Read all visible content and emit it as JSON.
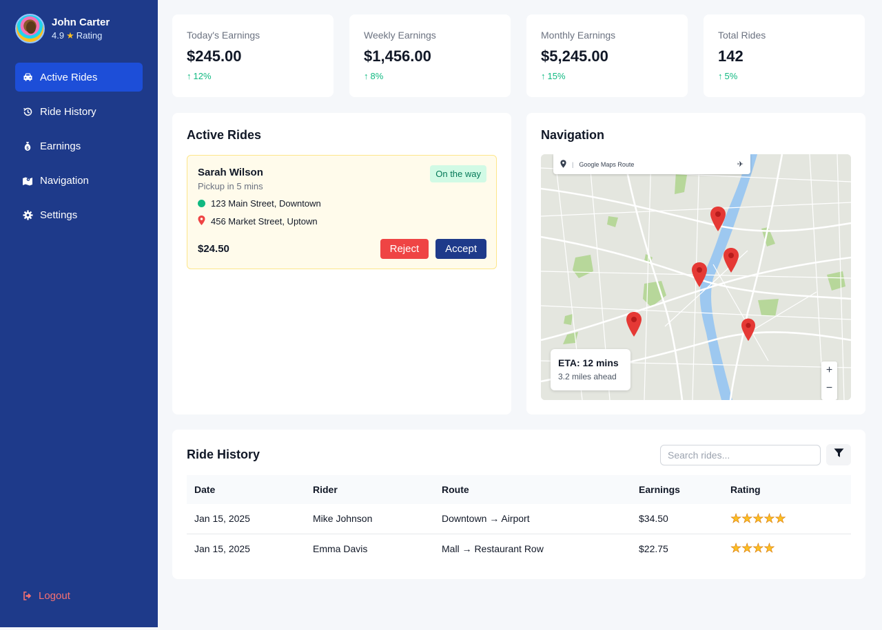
{
  "profile": {
    "name": "John Carter",
    "rating": "4.9",
    "rating_label": "Rating"
  },
  "nav": [
    {
      "label": "Active Rides",
      "icon": "car-icon",
      "active": true
    },
    {
      "label": "Ride History",
      "icon": "history-icon"
    },
    {
      "label": "Earnings",
      "icon": "money-bag-icon"
    },
    {
      "label": "Navigation",
      "icon": "map-icon"
    },
    {
      "label": "Settings",
      "icon": "gear-icon"
    }
  ],
  "logout_label": "Logout",
  "stats": [
    {
      "label": "Today's Earnings",
      "value": "$245.00",
      "change": "12%"
    },
    {
      "label": "Weekly Earnings",
      "value": "$1,456.00",
      "change": "8%"
    },
    {
      "label": "Monthly Earnings",
      "value": "$5,245.00",
      "change": "15%"
    },
    {
      "label": "Total Rides",
      "value": "142",
      "change": "5%"
    }
  ],
  "active_rides": {
    "title": "Active Rides",
    "ride": {
      "rider": "Sarah Wilson",
      "pickup": "Pickup in 5 mins",
      "status": "On the way",
      "from": "123 Main Street, Downtown",
      "to": "456 Market Street, Uptown",
      "fare": "$24.50",
      "reject_label": "Reject",
      "accept_label": "Accept"
    }
  },
  "navigation": {
    "title": "Navigation",
    "map_bar_label": "Google Maps Route",
    "eta": "ETA: 12 mins",
    "distance": "3.2 miles ahead",
    "zoom_in": "+",
    "zoom_out": "−"
  },
  "ride_history": {
    "title": "Ride History",
    "search_placeholder": "Search rides...",
    "columns": [
      "Date",
      "Rider",
      "Route",
      "Earnings",
      "Rating"
    ],
    "rows": [
      {
        "date": "Jan 15, 2025",
        "rider": "Mike Johnson",
        "route": "Downtown → Airport",
        "earnings": "$34.50",
        "rating": 5
      },
      {
        "date": "Jan 15, 2025",
        "rider": "Emma Davis",
        "route": "Mall → Restaurant Row",
        "earnings": "$22.75",
        "rating": 4
      }
    ]
  },
  "colors": {
    "sidebar": "#1e3a8a",
    "active_nav": "#1d4ed8",
    "accent_green": "#10b981",
    "reject": "#ef4444",
    "logout": "#f87171"
  }
}
